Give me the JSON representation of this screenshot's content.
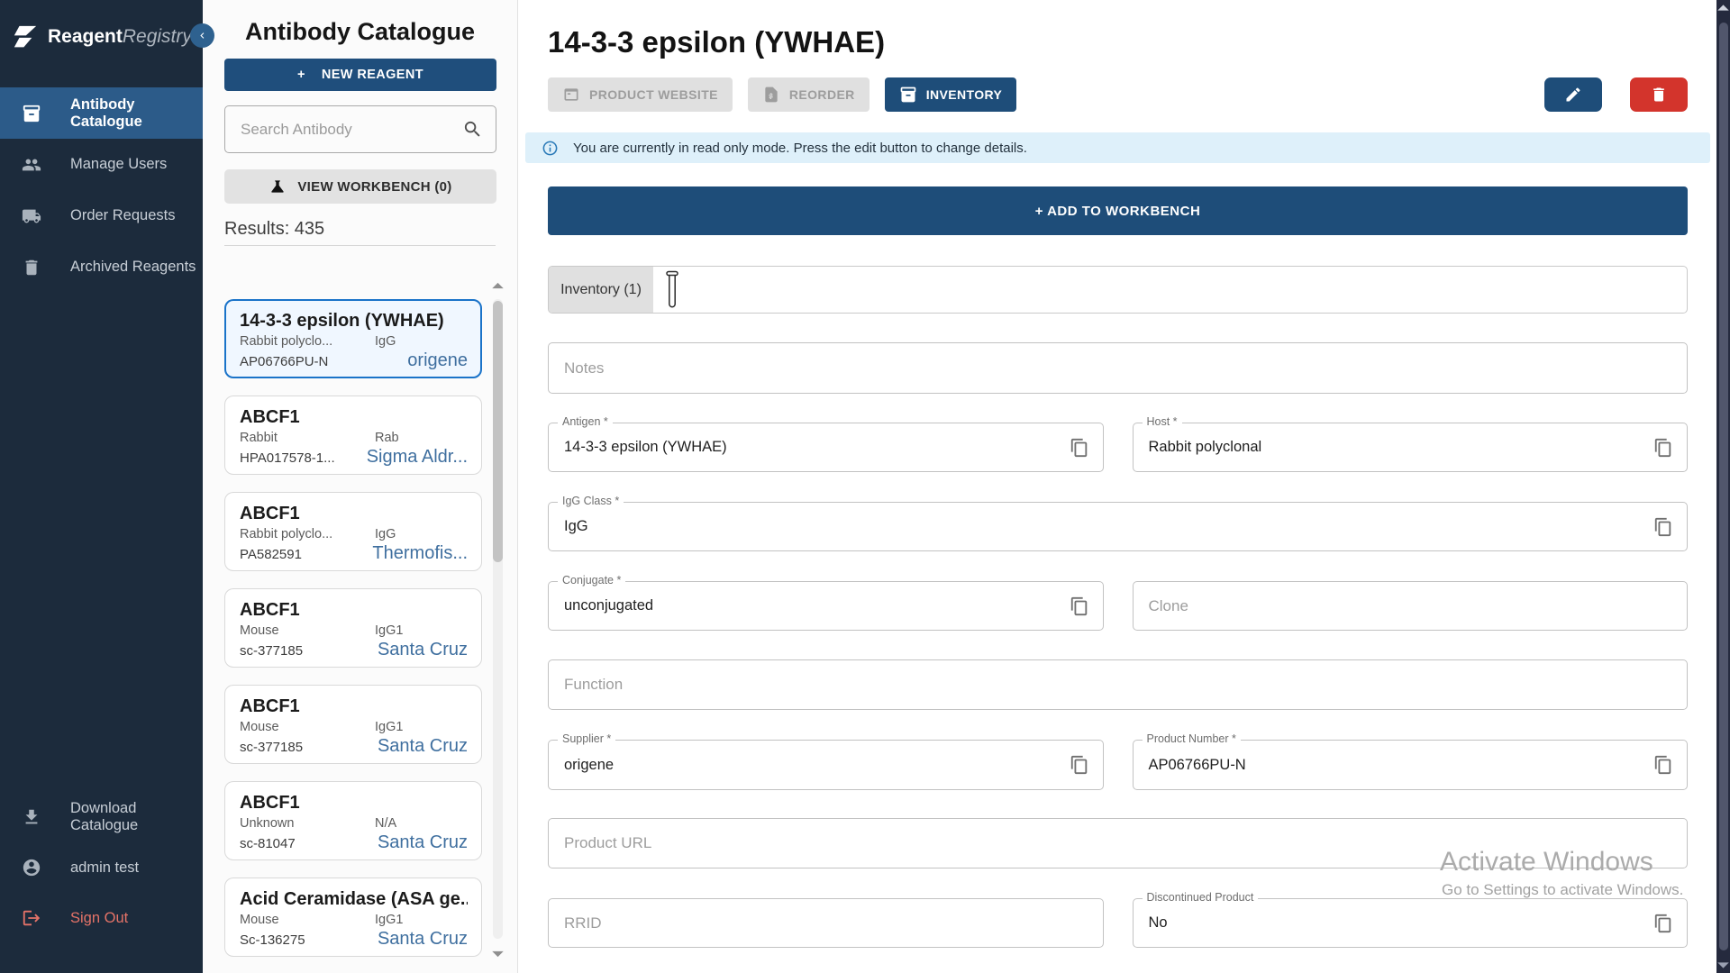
{
  "brand": {
    "bold": "Reagent",
    "italic": "Registry"
  },
  "colors": {
    "sidebar_bg": "#1c2b3c",
    "primary_blue": "#1e4d79",
    "nav_active": "#2c5b89",
    "danger_red": "#d3342c",
    "signout": "#e57368",
    "selected_card_border": "#1a73c9",
    "banner_bg": "#def0fa",
    "supplier_link": "#3f6f9f"
  },
  "sidebar": {
    "items": [
      {
        "label": "Antibody Catalogue"
      },
      {
        "label": "Manage Users"
      },
      {
        "label": "Order Requests"
      },
      {
        "label": "Archived Reagents"
      }
    ],
    "bottom": [
      {
        "label": "Download Catalogue"
      },
      {
        "label": "admin test"
      },
      {
        "label": "Sign Out"
      }
    ]
  },
  "catalogue": {
    "title": "Antibody Catalogue",
    "new_reagent_plus": "+",
    "new_reagent": "NEW REAGENT",
    "search_placeholder": "Search Antibody",
    "workbench": "VIEW WORKBENCH (0)",
    "results": "Results: 435",
    "cards": [
      {
        "name": "14-3-3 epsilon (YWHAE)",
        "host": "Rabbit polyclo...",
        "igg": "IgG",
        "code": "AP06766PU-N",
        "supplier": "origene"
      },
      {
        "name": "ABCF1",
        "host": "Rabbit",
        "igg": "Rab",
        "code": "HPA017578-1...",
        "supplier": "Sigma Aldr..."
      },
      {
        "name": "ABCF1",
        "host": "Rabbit polyclo...",
        "igg": "IgG",
        "code": "PA582591",
        "supplier": "Thermofis..."
      },
      {
        "name": "ABCF1",
        "host": "Mouse",
        "igg": "IgG1",
        "code": "sc-377185",
        "supplier": "Santa Cruz"
      },
      {
        "name": "ABCF1",
        "host": "Mouse",
        "igg": "IgG1",
        "code": "sc-377185",
        "supplier": "Santa Cruz"
      },
      {
        "name": "ABCF1",
        "host": "Unknown",
        "igg": "N/A",
        "code": "sc-81047",
        "supplier": "Santa Cruz"
      },
      {
        "name": "Acid Ceramidase (ASA ge...",
        "host": "Mouse",
        "igg": "IgG1",
        "code": "Sc-136275",
        "supplier": "Santa Cruz"
      }
    ]
  },
  "detail": {
    "title": "14-3-3 epsilon (YWHAE)",
    "product_website": "PRODUCT WEBSITE",
    "reorder": "REORDER",
    "inventory": "INVENTORY",
    "banner": "You are currently in read only mode. Press the edit button to change details.",
    "add_to_workbench": "+ ADD TO WORKBENCH",
    "inventory_tab": "Inventory (1)",
    "fields": {
      "notes_placeholder": "Notes",
      "antigen_label": "Antigen *",
      "antigen_value": "14-3-3 epsilon (YWHAE)",
      "host_label": "Host *",
      "host_value": "Rabbit polyclonal",
      "igg_label": "IgG Class *",
      "igg_value": "IgG",
      "conjugate_label": "Conjugate *",
      "conjugate_value": "unconjugated",
      "clone_placeholder": "Clone",
      "function_placeholder": "Function",
      "supplier_label": "Supplier *",
      "supplier_value": "origene",
      "product_number_label": "Product Number *",
      "product_number_value": "AP06766PU-N",
      "product_url_placeholder": "Product URL",
      "rrid_placeholder": "RRID",
      "discontinued_label": "Discontinued Product",
      "discontinued_value": "No"
    }
  },
  "watermark": {
    "line1": "Activate Windows",
    "line2": "Go to Settings to activate Windows."
  }
}
